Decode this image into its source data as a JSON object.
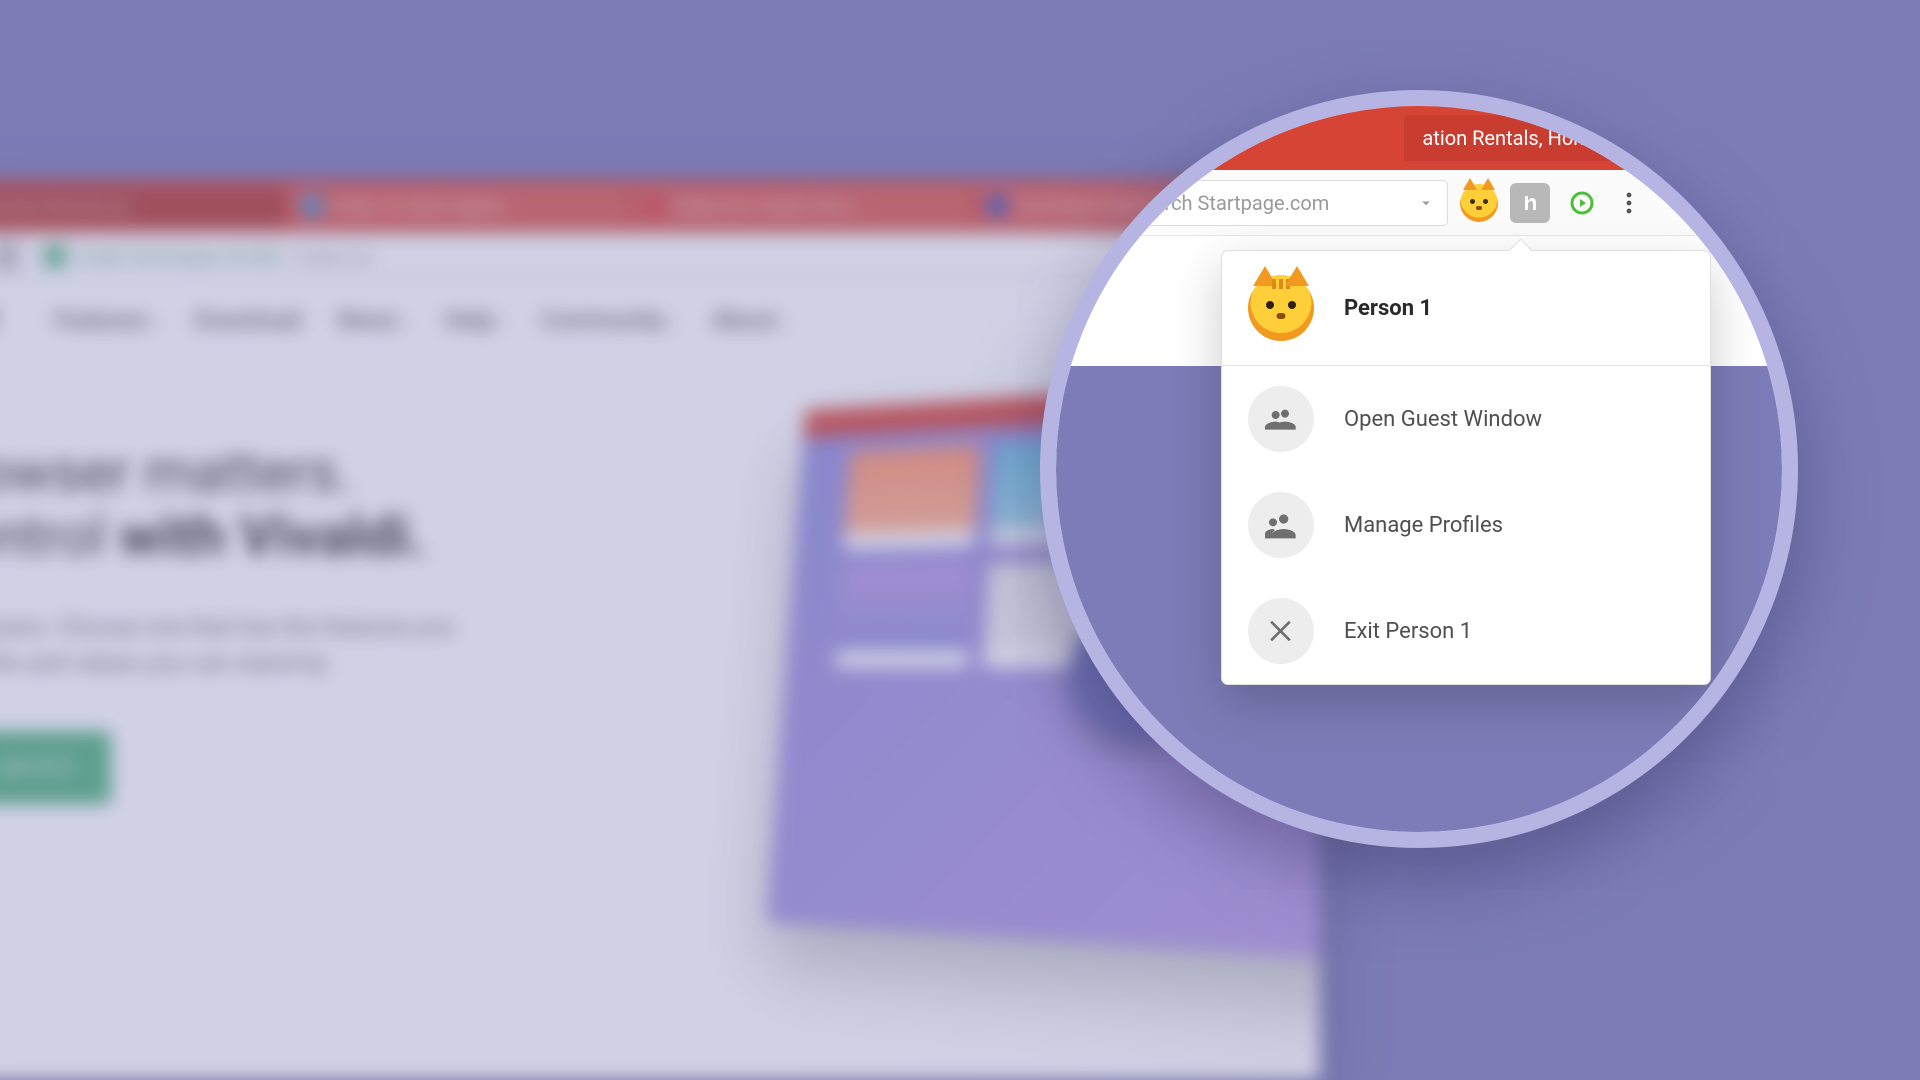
{
  "colors": {
    "page_bg": "#7d7cb8",
    "tabstrip": "#d64436",
    "circle_border": "#b6b4e3",
    "cta": "#4db27a"
  },
  "background_window": {
    "tabs": [
      {
        "label": "browser that puts you"
      },
      {
        "label": "Twitter. It's what's happen…"
      },
      {
        "label": "Hotels.com | Hotell | Find c…"
      },
      {
        "label": "The 30 Best United Kingdo…"
      }
    ],
    "url_badge_text": "Vivaldi Technologies AS (NO)",
    "url_text": "vivaldi.com",
    "nav": {
      "logo_fragment": "DI",
      "items": [
        "Features",
        "Download",
        "News",
        "Help",
        "Community",
        "About"
      ]
    },
    "hero": {
      "line1": "rowser matters.",
      "line2_plain": "ontrol ",
      "line2_strong": "with Vivaldi.",
      "sub1": "rowsers. Choose one that has the features you",
      "sub2": "at fits and values you can stand by.",
      "cta_label": "ad v2.3"
    }
  },
  "zoom": {
    "tab_label": "ation Rentals, Homes, E",
    "search_placeholder": "earch Startpage.com",
    "icons": {
      "new_tab": "plus-icon",
      "trash": "trash-icon",
      "dropdown": "chevron-down-icon",
      "profile": "cat-avatar-icon",
      "ext1": "h-extension-icon",
      "ext2": "play-extension-icon",
      "menu": "vertical-dots-icon"
    }
  },
  "profile_menu": {
    "current": "Person 1",
    "items": [
      {
        "id": "guest",
        "label": "Open Guest Window",
        "icon": "people-icon"
      },
      {
        "id": "manage",
        "label": "Manage Profiles",
        "icon": "person-gear-icon"
      },
      {
        "id": "exit",
        "label": "Exit Person 1",
        "icon": "close-icon"
      }
    ]
  }
}
